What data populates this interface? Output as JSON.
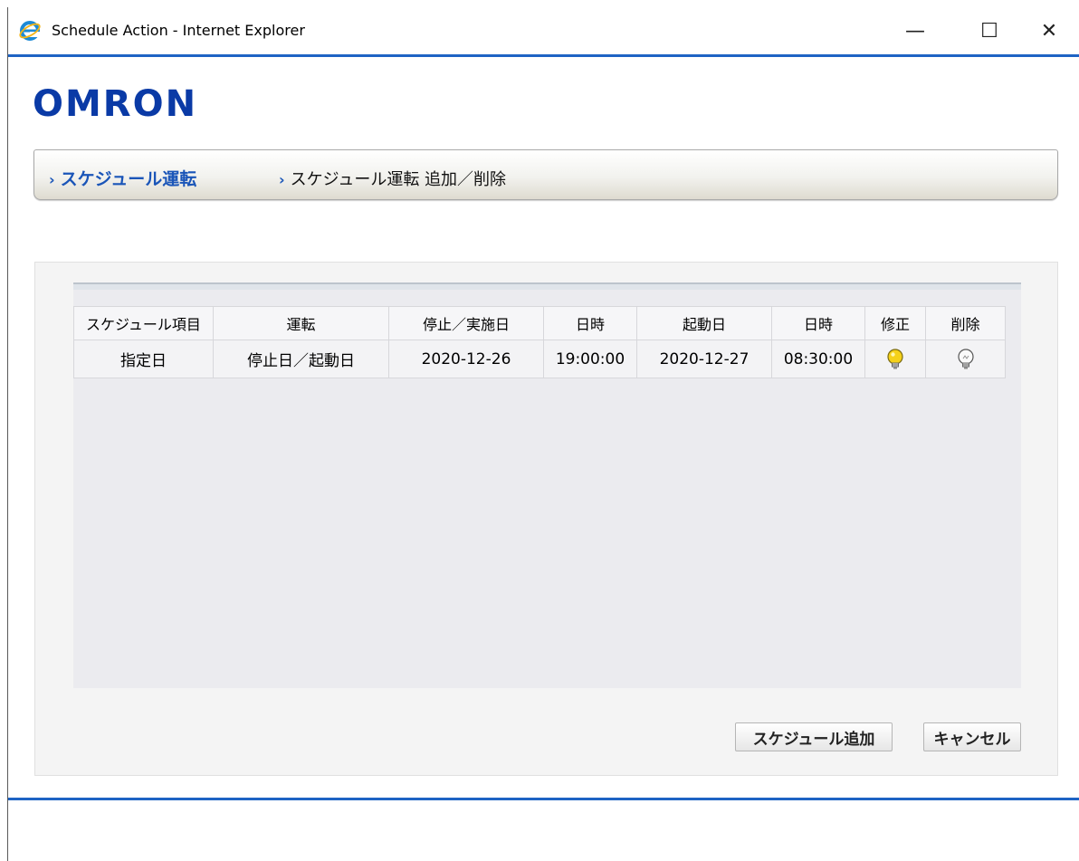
{
  "window": {
    "title": "Schedule Action - Internet Explorer",
    "controls": {
      "minimize": "—",
      "maximize": "☐",
      "close": "✕"
    }
  },
  "brand": {
    "logo_text": "OMRON"
  },
  "breadcrumb": {
    "level1": "スケジュール運転",
    "level2": "スケジュール運転 追加／削除"
  },
  "table": {
    "headers": [
      "スケジュール項目",
      "運転",
      "停止／実施日",
      "日時",
      "起動日",
      "日時",
      "修正",
      "削除"
    ],
    "rows": [
      {
        "item": "指定日",
        "operation": "停止日／起動日",
        "stop_date": "2020-12-26",
        "stop_time": "19:00:00",
        "start_date": "2020-12-27",
        "start_time": "08:30:00",
        "edit_icon": "lightbulb-on-icon",
        "delete_icon": "lightbulb-off-icon"
      }
    ]
  },
  "buttons": {
    "add_schedule": "スケジュール追加",
    "cancel": "キャンセル"
  },
  "colors": {
    "accent": "#1e63c4",
    "logo": "#0a3aa6",
    "bulb_on": "#f5d11a"
  }
}
